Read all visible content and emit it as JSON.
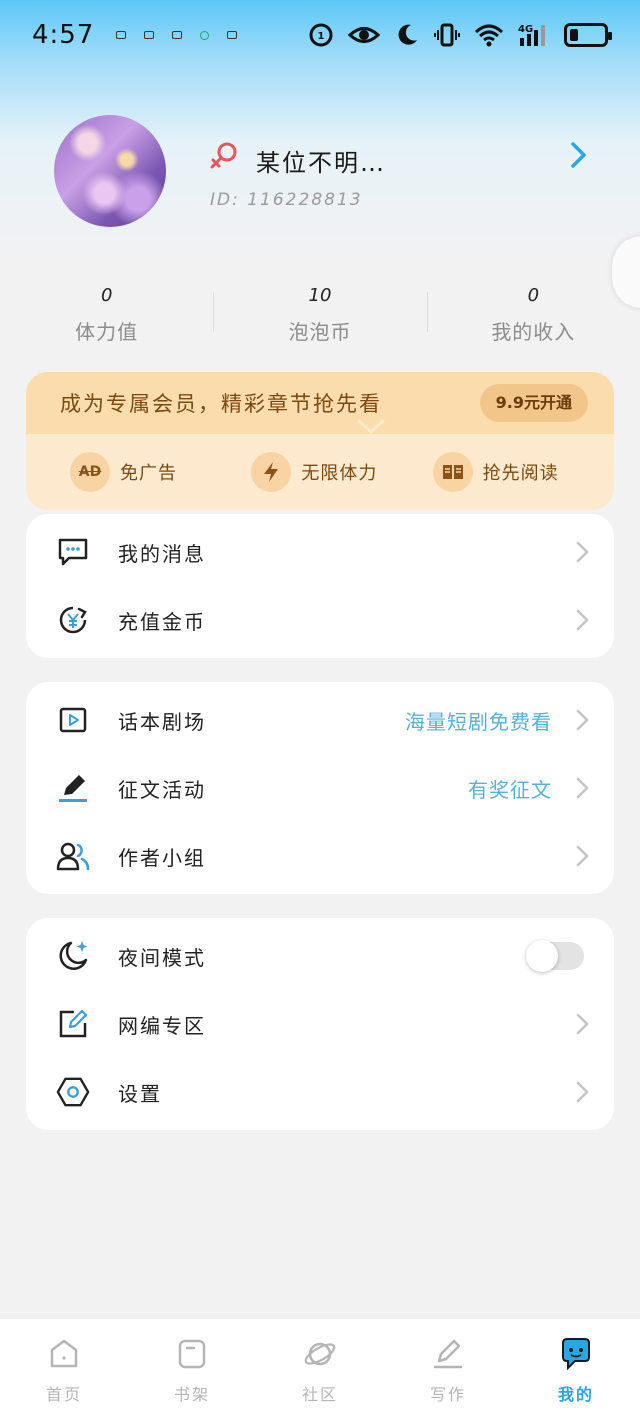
{
  "status_bar": {
    "time": "4:57",
    "network": "4G",
    "icons": [
      "app-notif-icon",
      "mail-icon",
      "mail-icon",
      "green-app-icon",
      "star-app-icon",
      "hd-call-icon",
      "eye-icon",
      "moon-icon",
      "vibrate-icon",
      "wifi-icon",
      "signal-icon",
      "battery-icon"
    ]
  },
  "profile": {
    "username": "某位不明…",
    "user_id": "ID: 116228813",
    "gender_icon": "female-icon"
  },
  "stats": [
    {
      "value": "0",
      "label": "体力值"
    },
    {
      "value": "10",
      "label": "泡泡币"
    },
    {
      "value": "0",
      "label": "我的收入"
    }
  ],
  "vip": {
    "title": "成为专属会员，精彩章节抢先看",
    "button": "9.9元开通",
    "perks": [
      {
        "icon": "ad-free-icon",
        "icon_text": "AD",
        "label": "免广告"
      },
      {
        "icon": "lightning-icon",
        "label": "无限体力"
      },
      {
        "icon": "book-icon",
        "label": "抢先阅读"
      }
    ]
  },
  "menu_group_1": [
    {
      "icon": "message-icon",
      "label": "我的消息"
    },
    {
      "icon": "coin-icon",
      "label": "充值金币"
    }
  ],
  "menu_group_2": [
    {
      "icon": "play-icon",
      "label": "话本剧场",
      "hint": "海量短剧免费看"
    },
    {
      "icon": "pen-icon",
      "label": "征文活动",
      "hint": "有奖征文"
    },
    {
      "icon": "group-icon",
      "label": "作者小组"
    }
  ],
  "menu_group_3": [
    {
      "icon": "night-mode-icon",
      "label": "夜间模式",
      "toggle": false
    },
    {
      "icon": "edit-icon",
      "label": "网编专区"
    },
    {
      "icon": "settings-icon",
      "label": "设置"
    }
  ],
  "bottom_nav": [
    {
      "icon": "home-icon",
      "label": "首页",
      "active": false
    },
    {
      "icon": "bookshelf-icon",
      "label": "书架",
      "active": false
    },
    {
      "icon": "planet-icon",
      "label": "社区",
      "active": false
    },
    {
      "icon": "write-icon",
      "label": "写作",
      "active": false
    },
    {
      "icon": "mine-icon",
      "label": "我的",
      "active": true
    }
  ],
  "colors": {
    "accent": "#2aa6e4",
    "hint": "#5aafd6",
    "vip_text": "#7b4a12",
    "vip_bg": "#fde9cd",
    "gender": "#e8545b"
  }
}
